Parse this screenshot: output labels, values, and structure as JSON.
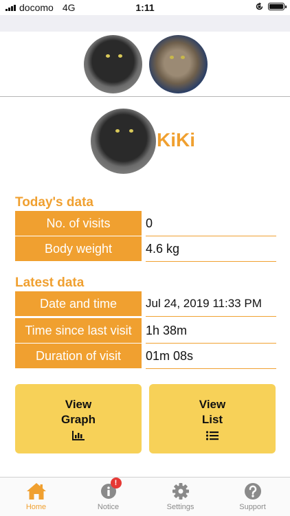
{
  "status_bar": {
    "carrier": "docomo",
    "network": "4G",
    "time": "1:11"
  },
  "cats": [
    {
      "name": "black-cat"
    },
    {
      "name": "tabby-cat"
    }
  ],
  "selected_cat": {
    "name": "KiKi"
  },
  "today": {
    "title": "Today's data",
    "rows": [
      {
        "label": "No. of visits",
        "value": "0"
      },
      {
        "label": "Body weight",
        "value": "4.6 kg"
      }
    ]
  },
  "latest": {
    "title": "Latest data",
    "rows": [
      {
        "label": "Date and time",
        "value": "Jul 24, 2019 11:33 PM"
      },
      {
        "label": "Time since last visit",
        "value": "1h 38m"
      },
      {
        "label": "Duration of visit",
        "value": "01m 08s"
      }
    ]
  },
  "buttons": {
    "graph": {
      "line1": "View",
      "line2": "Graph",
      "icon": "bar-chart-icon"
    },
    "list": {
      "line1": "View",
      "line2": "List",
      "icon": "list-icon"
    }
  },
  "tabs": [
    {
      "label": "Home",
      "icon": "home-icon",
      "active": true
    },
    {
      "label": "Notice",
      "icon": "info-icon",
      "badge": "!"
    },
    {
      "label": "Settings",
      "icon": "gear-icon"
    },
    {
      "label": "Support",
      "icon": "question-icon"
    }
  ],
  "colors": {
    "accent": "#f0a030",
    "button": "#f7d158",
    "badge": "#e53935"
  }
}
